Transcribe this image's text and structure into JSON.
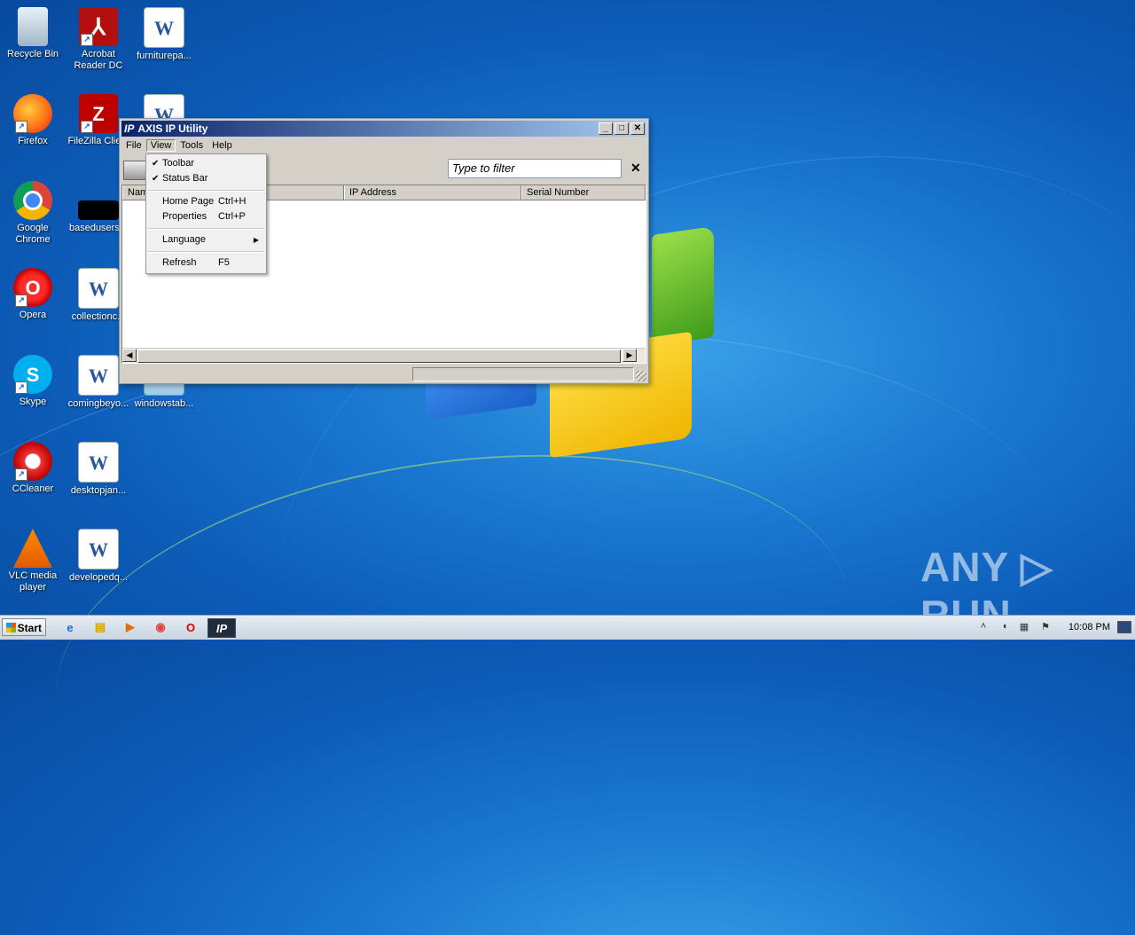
{
  "desktop": {
    "icons": [
      {
        "label": "Recycle Bin",
        "glyph": "recycle-bin-icon"
      },
      {
        "label": "Acrobat\nReader DC",
        "glyph": "acrobat-icon"
      },
      {
        "label": "furniturepa...",
        "glyph": "word-doc-icon"
      },
      {
        "label": "Firefox",
        "glyph": "firefox-icon"
      },
      {
        "label": "FileZilla Clie...",
        "glyph": "filezilla-icon"
      },
      {
        "label": "",
        "glyph": "word-doc-icon"
      },
      {
        "label": "Google\nChrome",
        "glyph": "chrome-icon"
      },
      {
        "label": "basedusers...",
        "glyph": "black-file-icon"
      },
      {
        "label": "Opera",
        "glyph": "opera-icon"
      },
      {
        "label": "collectionc...",
        "glyph": "word-doc-icon"
      },
      {
        "label": "Skype",
        "glyph": "skype-icon"
      },
      {
        "label": "comingbeyo...",
        "glyph": "word-doc-icon"
      },
      {
        "label": "windowstab...",
        "glyph": "file-icon"
      },
      {
        "label": "CCleaner",
        "glyph": "ccleaner-icon"
      },
      {
        "label": "desktopjan...",
        "glyph": "word-doc-icon"
      },
      {
        "label": "VLC media\nplayer",
        "glyph": "vlc-icon"
      },
      {
        "label": "developedq...",
        "glyph": "word-doc-icon"
      }
    ],
    "watermark": "ANY ▷ RUN"
  },
  "window": {
    "title_icon": "IP",
    "title": "AXIS IP Utility",
    "menus": [
      "File",
      "View",
      "Tools",
      "Help"
    ],
    "filter_placeholder": "Type to filter",
    "filter_clear": "✕",
    "columns": [
      "Name",
      "IP Address",
      "Serial Number"
    ],
    "column_name_visible": "Nam"
  },
  "view_menu": {
    "items": [
      {
        "label": "Toolbar",
        "checked": "✔",
        "shortcut": ""
      },
      {
        "label": "Status Bar",
        "checked": "✔",
        "shortcut": ""
      },
      {
        "label": "Home Page",
        "checked": "",
        "shortcut": "Ctrl+H"
      },
      {
        "label": "Properties",
        "checked": "",
        "shortcut": "Ctrl+P"
      },
      {
        "label": "Language",
        "checked": "",
        "shortcut": "",
        "submenu": "▶"
      },
      {
        "label": "Refresh",
        "checked": "",
        "shortcut": "F5"
      }
    ]
  },
  "taskbar": {
    "start_label": "Start",
    "active_item": "IP",
    "clock": "10:08 PM"
  }
}
